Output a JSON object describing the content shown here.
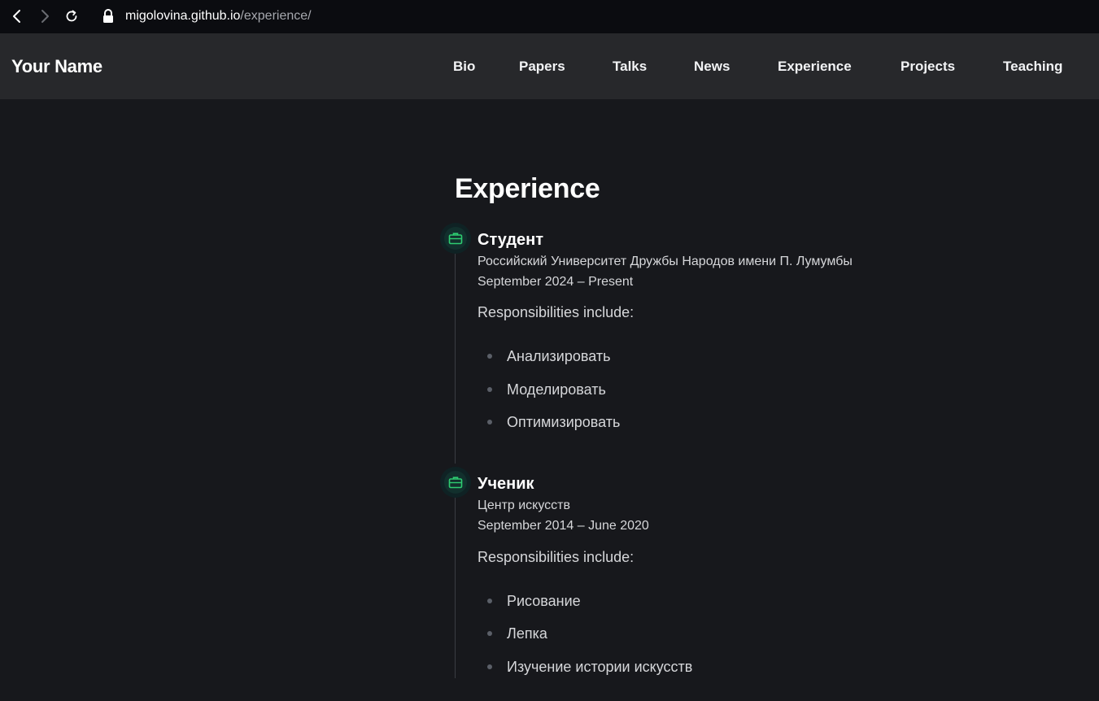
{
  "browser": {
    "url_host": "migolovina.github.io",
    "url_path": "/experience/",
    "back_icon": "chevron-left-icon",
    "forward_icon": "chevron-right-icon",
    "reload_icon": "reload-icon",
    "lock_icon": "lock-icon"
  },
  "header": {
    "brand": "Your Name",
    "nav": [
      "Bio",
      "Papers",
      "Talks",
      "News",
      "Experience",
      "Projects",
      "Teaching"
    ]
  },
  "main": {
    "title": "Experience",
    "entries": [
      {
        "icon": "briefcase-icon",
        "title": "Студент",
        "organization": "Российский Университет Дружбы Народов имени П. Лумумбы",
        "dates": "September 2024 – Present",
        "responsibilities_label": "Responsibilities include:",
        "items": [
          "Анализировать",
          "Моделировать",
          "Оптимизировать"
        ]
      },
      {
        "icon": "briefcase-icon",
        "title": "Ученик",
        "organization": "Центр искусств",
        "dates": "September 2014 – June 2020",
        "responsibilities_label": "Responsibilities include:",
        "items": [
          "Рисование",
          "Лепка",
          "Изучение истории искусств"
        ]
      }
    ]
  },
  "colors": {
    "background": "#17181c",
    "header_bg": "#27282b",
    "browser_bg": "#0b0c10",
    "accent_icon": "#2ecc71"
  }
}
